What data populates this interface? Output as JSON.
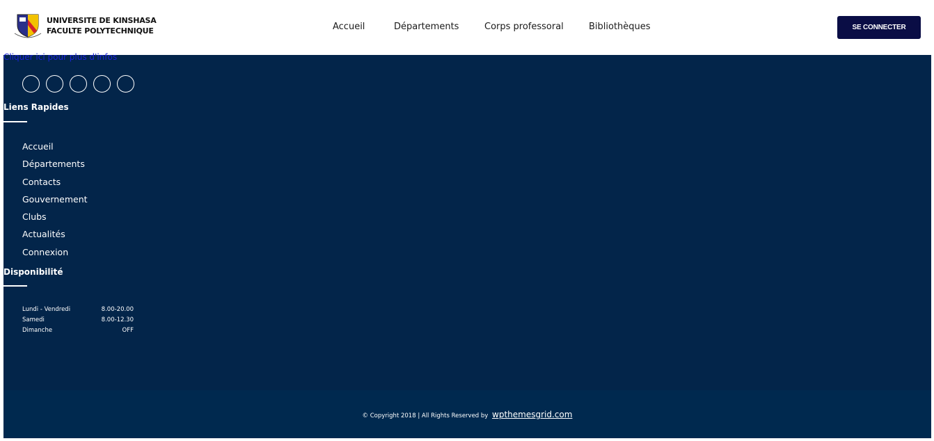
{
  "header": {
    "brand_line1": "UNIVERSITE DE KINSHASA",
    "brand_line2": "FACULTE POLYTECHNIQUE",
    "nav": [
      "Accueil",
      "Départements",
      "Corps professoral",
      "Bibliothèques"
    ],
    "login_label": "SE CONNECTER"
  },
  "footer": {
    "broken_link": "Cliquer ici pour plus d'infos",
    "social_icons": [
      "facebook-icon",
      "twitter-icon",
      "instagram-icon",
      "linkedin-icon",
      "youtube-icon"
    ],
    "quick_links_title": "Liens Rapides",
    "quick_links": [
      "Accueil",
      "Départements",
      "Contacts",
      "Gouvernement",
      "Clubs",
      "Actualités",
      "Connexion"
    ],
    "availability_title": "Disponibilité",
    "hours": [
      {
        "day": "Lundi - Vendredi",
        "time": "8.00-20.00"
      },
      {
        "day": "Samedi",
        "time": "8.00-12.30"
      },
      {
        "day": "Dimanche",
        "time": "OFF"
      }
    ],
    "copyright_text": "© Copyright 2018 | All Rights Reserved by",
    "copyright_link": "wpthemesgrid.com"
  },
  "colors": {
    "footer_bg": "#03254a",
    "bottom_bg": "#00294f",
    "button_bg": "#0a0d45",
    "link_blue": "#1a22d6"
  }
}
